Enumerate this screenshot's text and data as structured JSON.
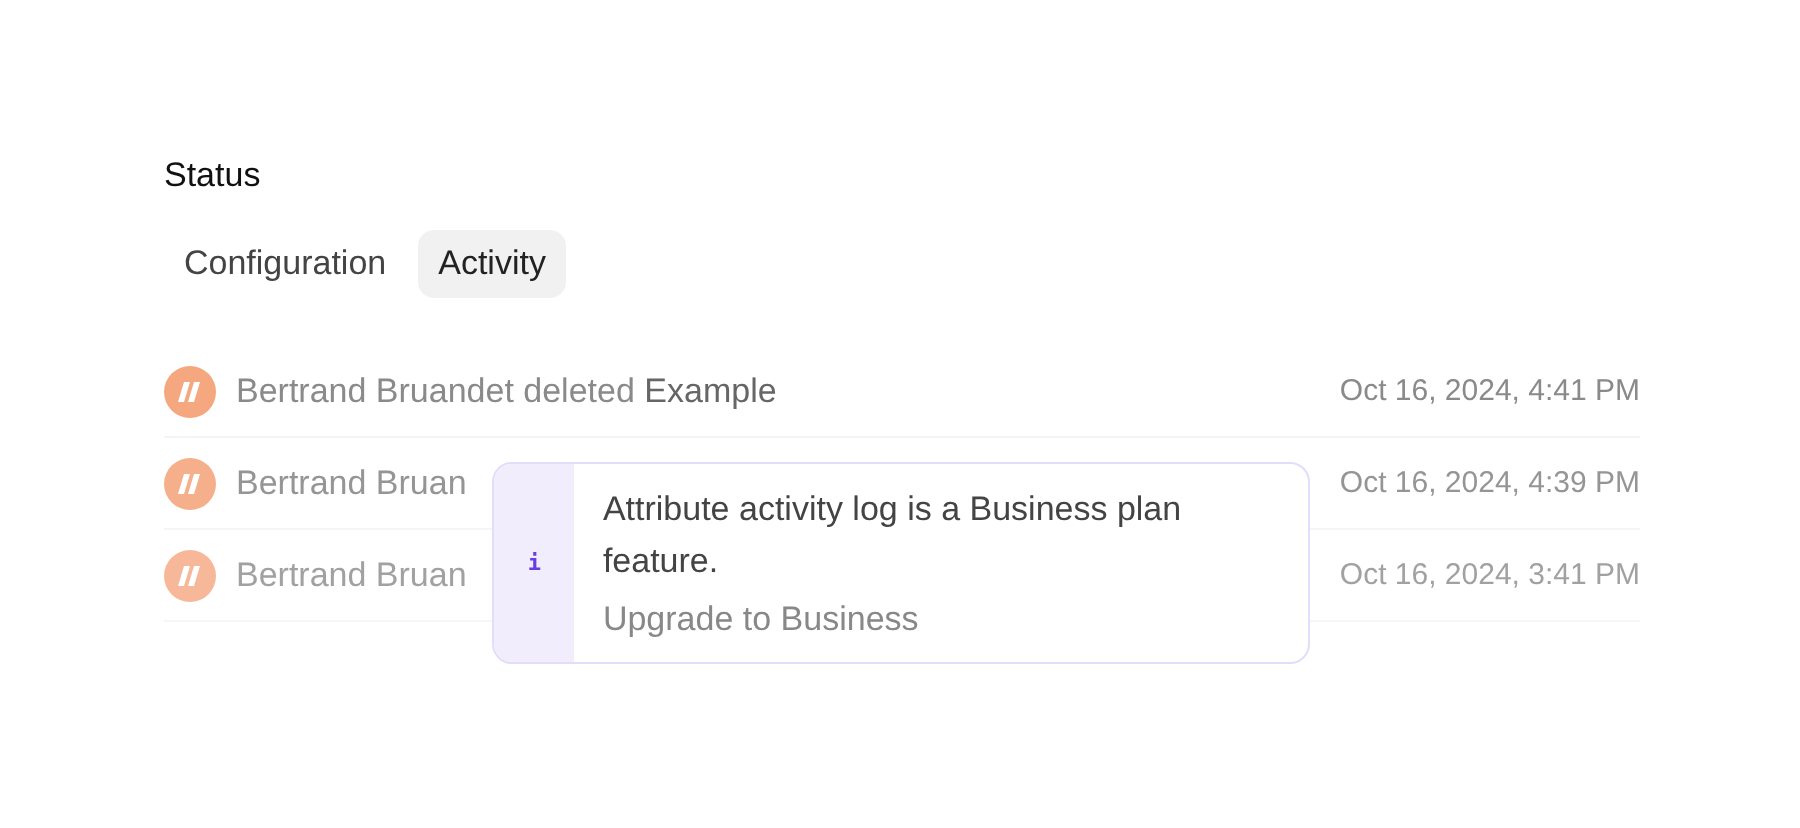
{
  "heading": "Status",
  "tabs": [
    {
      "label": "Configuration",
      "selected": false
    },
    {
      "label": "Activity",
      "selected": true
    }
  ],
  "activity": [
    {
      "text": "Bertrand Bruandet deleted **Example**",
      "time": "Oct 16, 2024, 4:41 PM"
    },
    {
      "text": "Bertrand Bruan",
      "time": "Oct 16, 2024, 4:39 PM"
    },
    {
      "text": "Bertrand Bruan",
      "time": "Oct 16, 2024, 3:41 PM"
    }
  ],
  "tooltip": {
    "icon": "i",
    "message": "Attribute activity log is a Business plan feature.",
    "link": "Upgrade to Business"
  }
}
